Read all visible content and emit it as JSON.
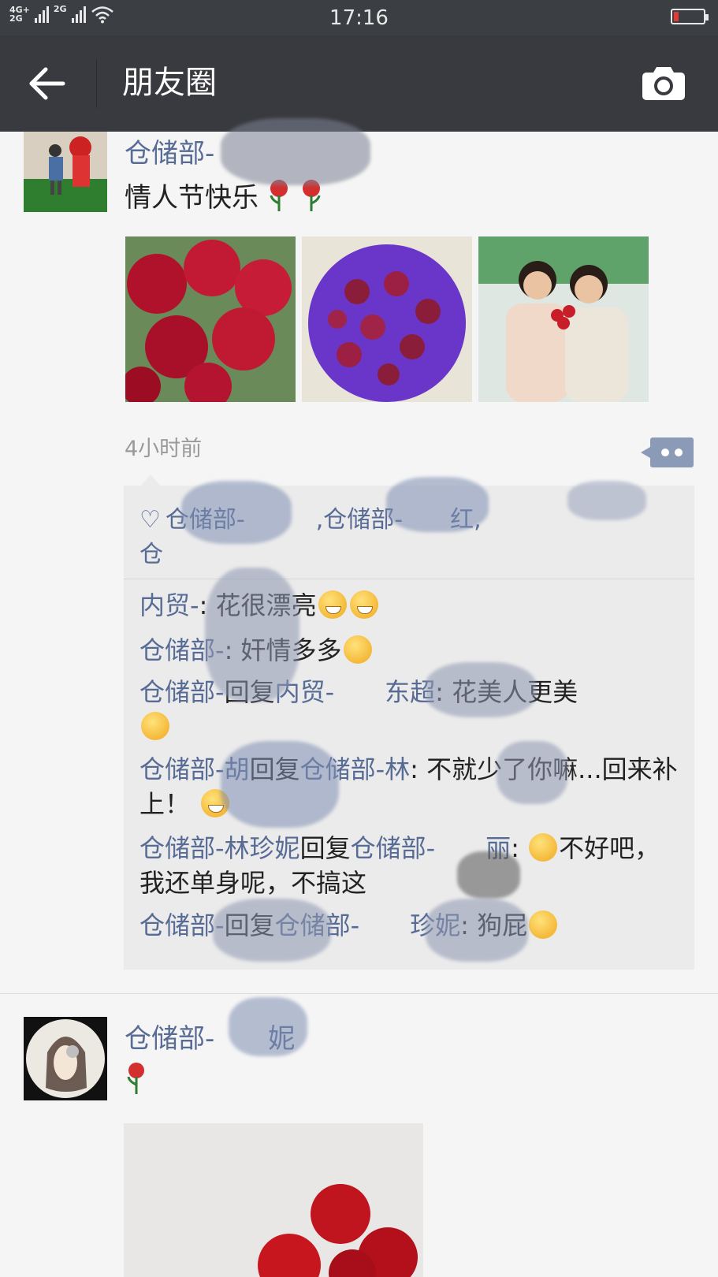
{
  "status_bar": {
    "network_top": "4G+",
    "network_bottom": "2G",
    "network2": "2G",
    "time": "17:16"
  },
  "nav": {
    "title": "朋友圈"
  },
  "post1": {
    "author": "仓储部-",
    "text": "情人节快乐",
    "time_ago": "4小时前",
    "likes": "仓储部-　　　,仓储部-　　红,",
    "likes_line2": "仓",
    "comments": [
      {
        "name": "内贸-",
        "sep": ": ",
        "reply_word": "",
        "reply_name": "",
        "text": "花很漂亮"
      },
      {
        "name": "仓储部-",
        "sep": ": ",
        "reply_word": "",
        "reply_name": "",
        "text": "奸情多多"
      },
      {
        "name": "仓储部-",
        "sep": ": ",
        "reply_word": "回复",
        "reply_name": "内贸-　　东超",
        "text": "花美人更美"
      },
      {
        "name": "仓储部-胡",
        "sep": ": ",
        "reply_word": "回复",
        "reply_name": "仓储部-林",
        "text": "不就少了你嘛...回来补上！"
      },
      {
        "name": "仓储部-林珍妮",
        "sep": ": ",
        "reply_word": "回复",
        "reply_name": "仓储部-　　丽",
        "text": "不好吧，我还单身呢，不搞这"
      },
      {
        "name": "仓储部-",
        "sep": ": ",
        "reply_word": "回复",
        "reply_name": "仓储部-　　珍妮",
        "text": "狗屁"
      }
    ]
  },
  "post2": {
    "author": "仓储部-　　妮"
  },
  "colors": {
    "nav_bg": "#393a3f",
    "name_blue": "#576b95",
    "comment_bg": "#ebebeb"
  }
}
